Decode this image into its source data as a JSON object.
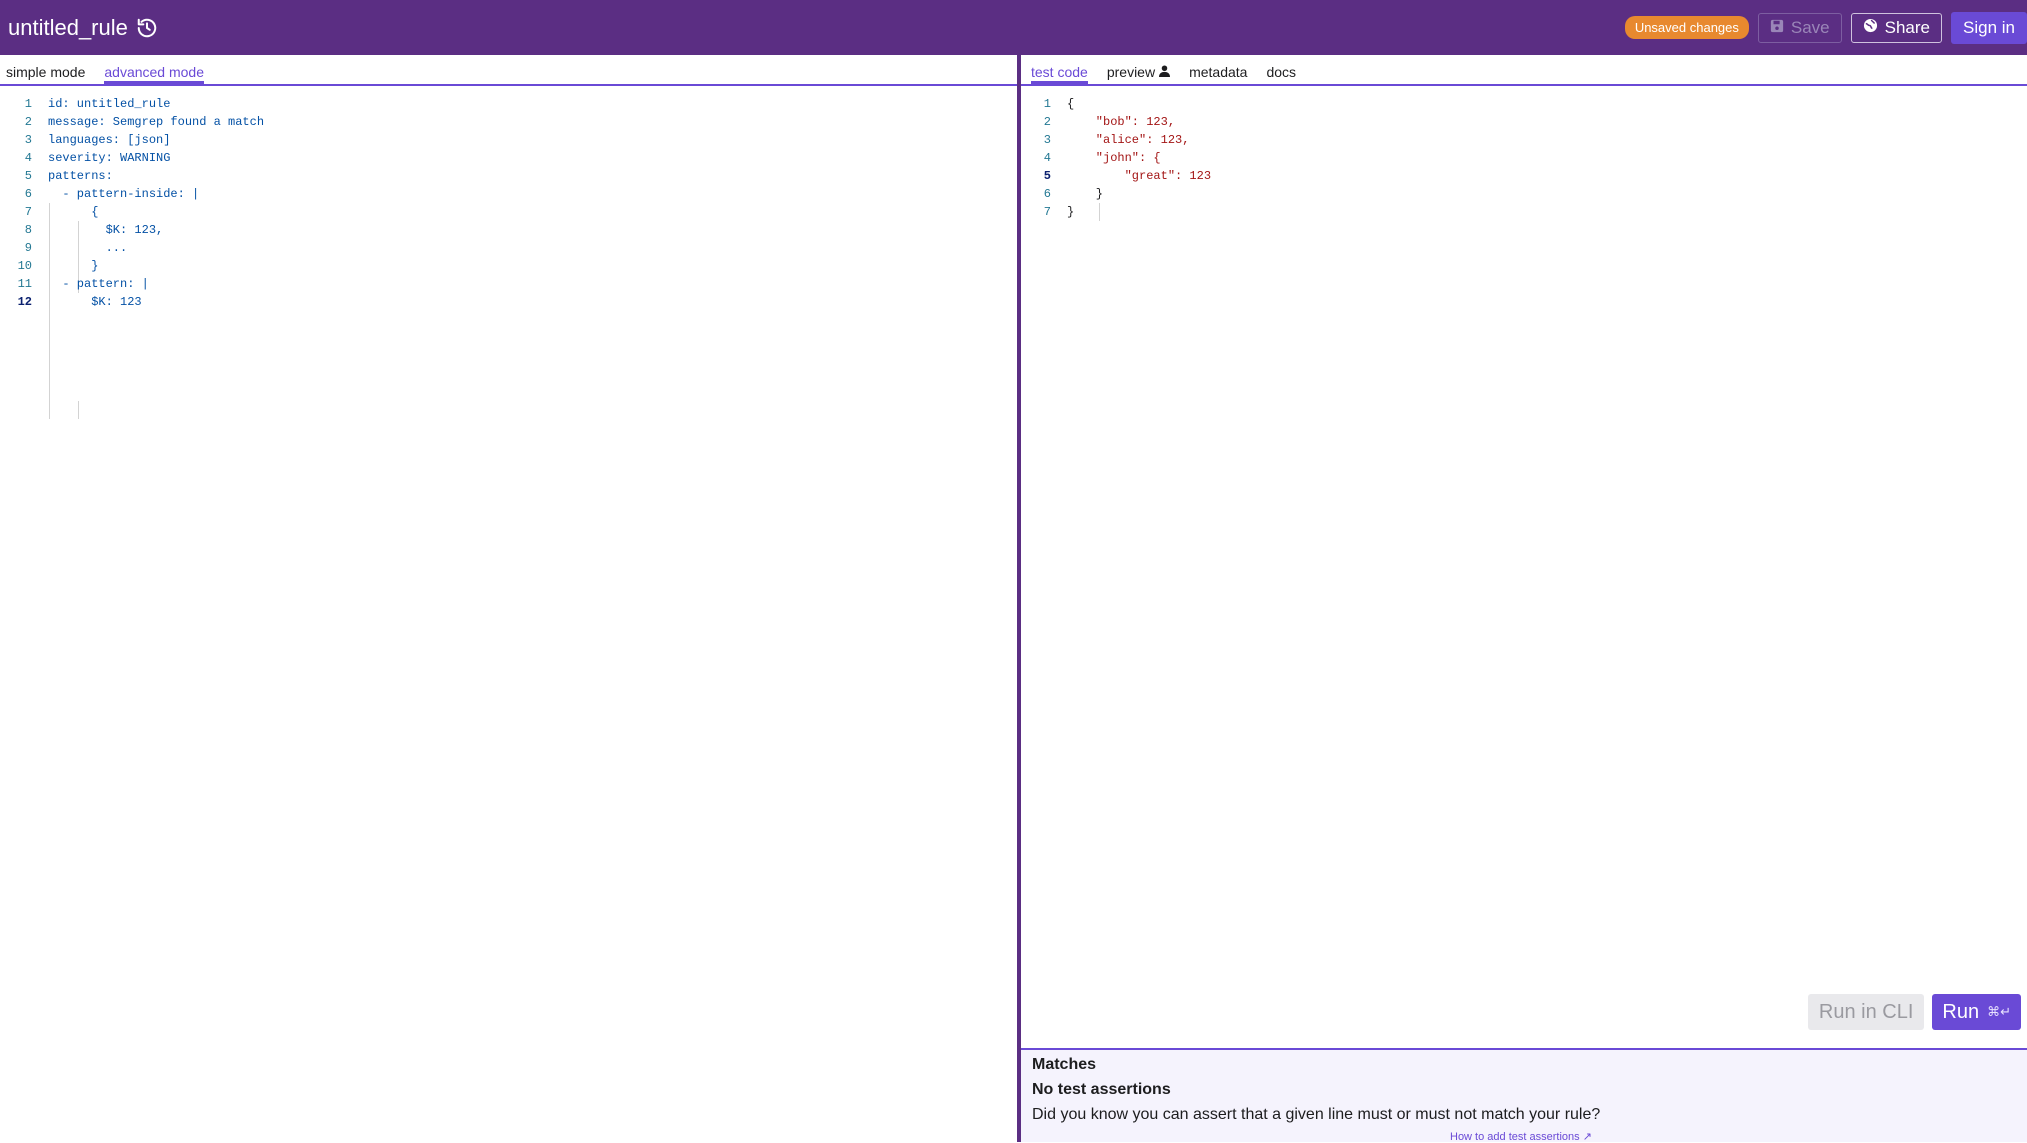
{
  "header": {
    "title": "untitled_rule",
    "unsaved_badge": "Unsaved changes",
    "save_label": "Save",
    "share_label": "Share",
    "signin_label": "Sign in",
    "colors": {
      "bar": "#5b2e83",
      "accent": "#6a4ad6",
      "badge": "#e8892f"
    }
  },
  "left": {
    "tabs": [
      "simple mode",
      "advanced mode"
    ],
    "active_tab": "advanced mode",
    "lines": [
      {
        "n": "1",
        "text": "id: untitled_rule"
      },
      {
        "n": "2",
        "text": "message: Semgrep found a match"
      },
      {
        "n": "3",
        "text": "languages: [json]"
      },
      {
        "n": "4",
        "text": "severity: WARNING"
      },
      {
        "n": "5",
        "text": "patterns:"
      },
      {
        "n": "6",
        "text": "  - pattern-inside: |"
      },
      {
        "n": "7",
        "text": "      {"
      },
      {
        "n": "8",
        "text": "        $K: 123,"
      },
      {
        "n": "9",
        "text": "        ..."
      },
      {
        "n": "10",
        "text": "      }"
      },
      {
        "n": "11",
        "text": "  - pattern: |"
      },
      {
        "n": "12",
        "text": "      $K: 123"
      }
    ]
  },
  "right": {
    "tabs": [
      "test code",
      "preview",
      "metadata",
      "docs"
    ],
    "active_tab": "test code",
    "lines": [
      {
        "n": "1",
        "text": "{"
      },
      {
        "n": "2",
        "text": "    \"bob\": 123,"
      },
      {
        "n": "3",
        "text": "    \"alice\": 123,"
      },
      {
        "n": "4",
        "text": "    \"john\": {"
      },
      {
        "n": "5",
        "text": "        \"great\": 123"
      },
      {
        "n": "6",
        "text": "    }"
      },
      {
        "n": "7",
        "text": "}"
      }
    ],
    "run_cli_label": "Run in CLI",
    "run_label": "Run",
    "run_shortcut": "⌘↵",
    "matches": {
      "title": "Matches",
      "subtitle": "No test assertions",
      "hint": "Did you know you can assert that a given line must or must not match your rule?",
      "link": "How to add test assertions"
    }
  }
}
